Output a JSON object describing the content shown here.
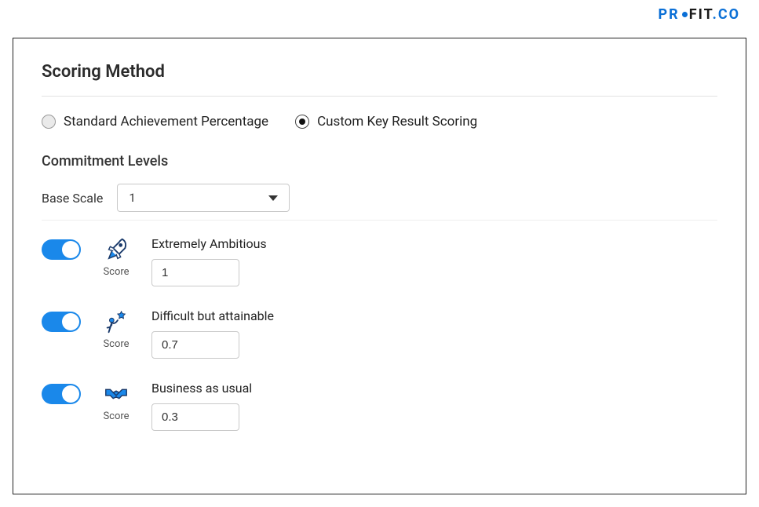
{
  "brand": {
    "p1": "PR",
    "p2": "FIT",
    "p3": "CO"
  },
  "title": "Scoring Method",
  "options": {
    "standard": "Standard Achievement Percentage",
    "custom": "Custom Key Result Scoring"
  },
  "commitment": {
    "heading": "Commitment Levels",
    "base_scale_label": "Base Scale",
    "base_scale_value": "1",
    "score_label": "Score",
    "levels": [
      {
        "title": "Extremely Ambitious",
        "score": "1"
      },
      {
        "title": "Difficult but attainable",
        "score": "0.7"
      },
      {
        "title": "Business as usual",
        "score": "0.3"
      }
    ]
  }
}
